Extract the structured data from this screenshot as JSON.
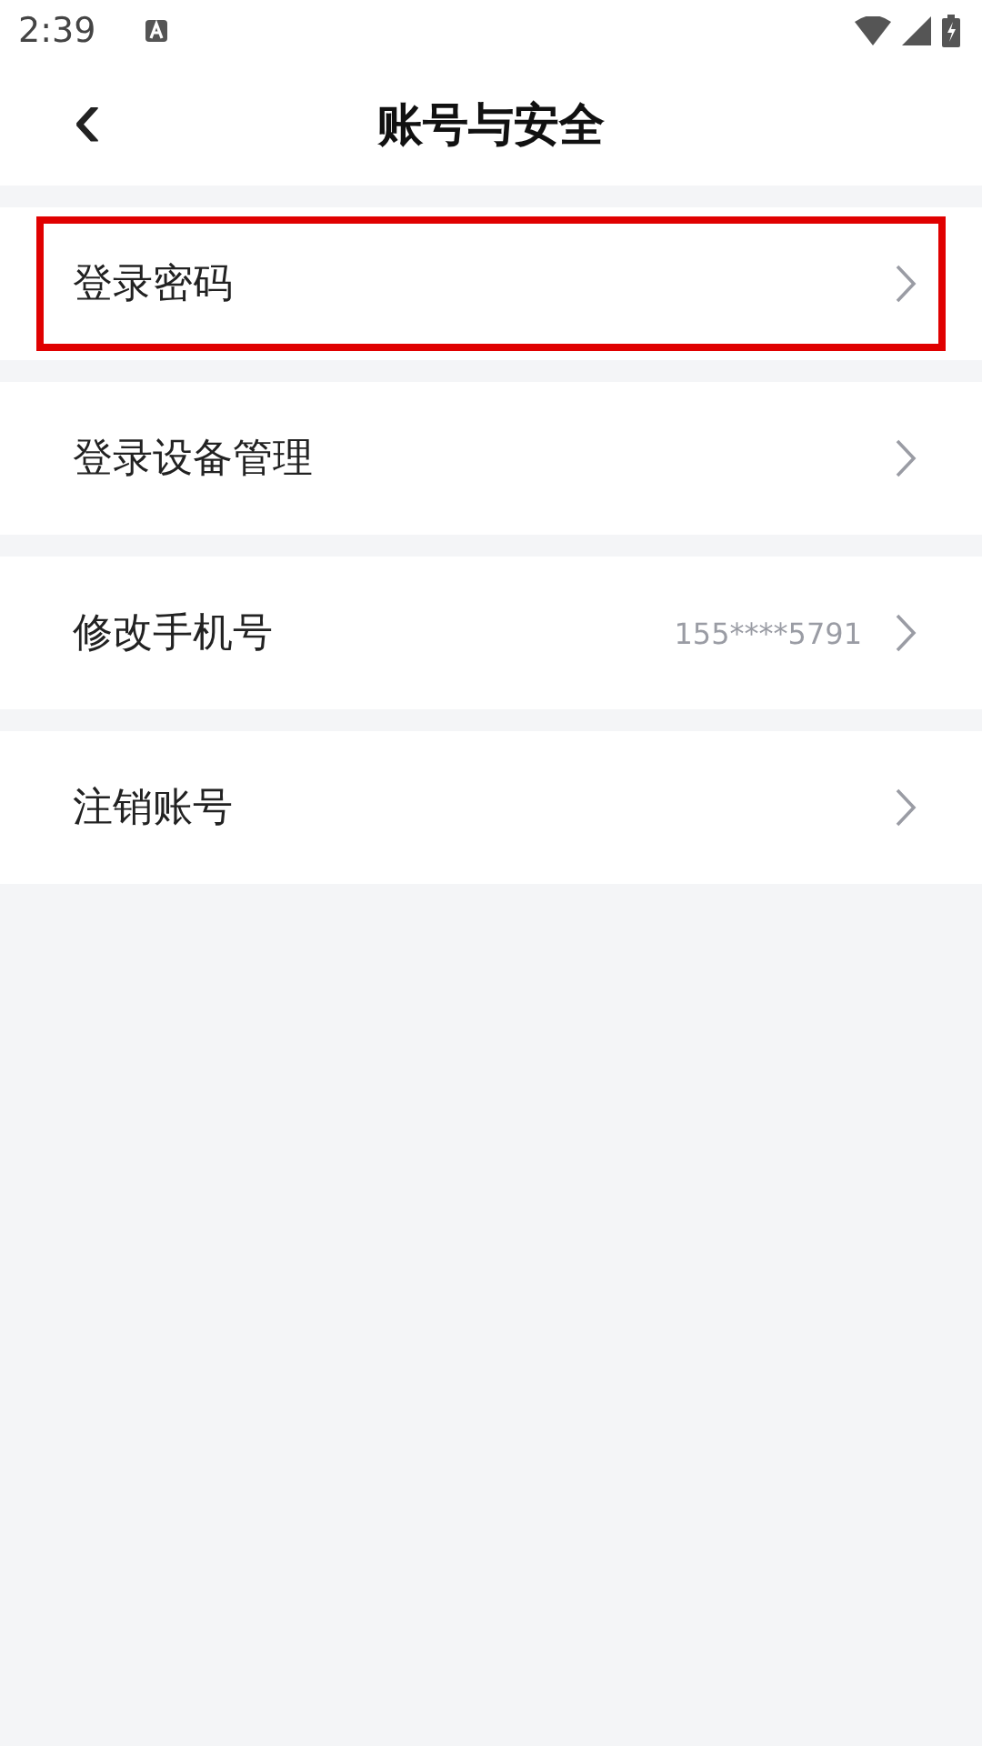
{
  "status_bar": {
    "time": "2:39"
  },
  "header": {
    "back": "‹",
    "title": "账号与安全"
  },
  "items": [
    {
      "label": "登录密码",
      "value": null,
      "highlighted": true
    },
    {
      "label": "登录设备管理",
      "value": null,
      "highlighted": false
    },
    {
      "label": "修改手机号",
      "value": "155****5791",
      "highlighted": false
    },
    {
      "label": "注销账号",
      "value": null,
      "highlighted": false
    }
  ]
}
